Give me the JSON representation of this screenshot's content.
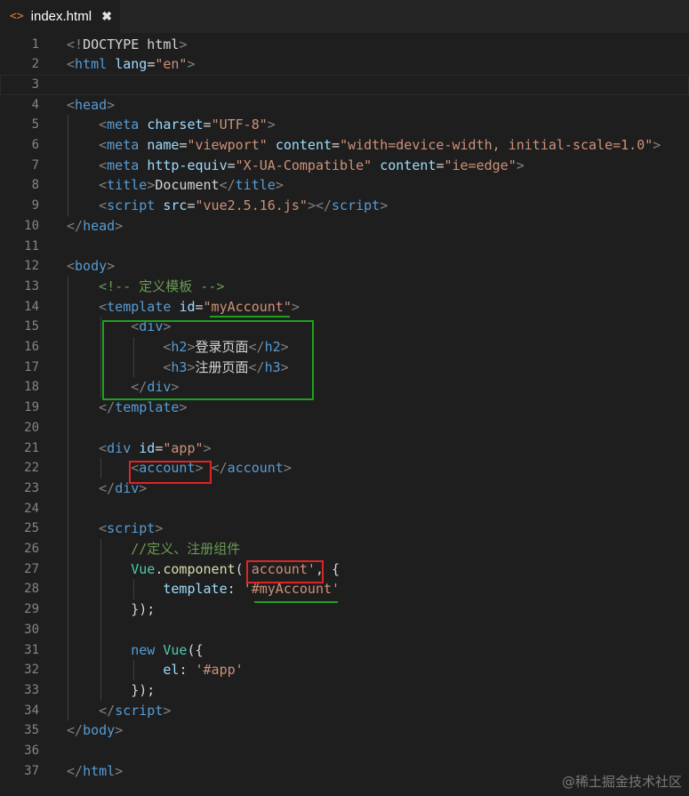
{
  "tab": {
    "icon": "html-file-icon",
    "filename": "index.html",
    "close_glyph": "✖"
  },
  "lines": [
    [
      [
        "p",
        "<!"
      ],
      [
        "x",
        "DOCTYPE html"
      ],
      [
        "p",
        ">"
      ]
    ],
    [
      [
        "p",
        "<"
      ],
      [
        "t",
        "html"
      ],
      [
        "x",
        " "
      ],
      [
        "a",
        "lang"
      ],
      [
        "x",
        "="
      ],
      [
        "s",
        "\"en\""
      ],
      [
        "p",
        ">"
      ]
    ],
    [],
    [
      [
        "p",
        "<"
      ],
      [
        "t",
        "head"
      ],
      [
        "p",
        ">"
      ]
    ],
    [
      [
        "x",
        "    "
      ],
      [
        "p",
        "<"
      ],
      [
        "t",
        "meta"
      ],
      [
        "x",
        " "
      ],
      [
        "a",
        "charset"
      ],
      [
        "x",
        "="
      ],
      [
        "s",
        "\"UTF-8\""
      ],
      [
        "p",
        ">"
      ]
    ],
    [
      [
        "x",
        "    "
      ],
      [
        "p",
        "<"
      ],
      [
        "t",
        "meta"
      ],
      [
        "x",
        " "
      ],
      [
        "a",
        "name"
      ],
      [
        "x",
        "="
      ],
      [
        "s",
        "\"viewport\""
      ],
      [
        "x",
        " "
      ],
      [
        "a",
        "content"
      ],
      [
        "x",
        "="
      ],
      [
        "s",
        "\"width=device-width, initial-scale=1.0\""
      ],
      [
        "p",
        ">"
      ]
    ],
    [
      [
        "x",
        "    "
      ],
      [
        "p",
        "<"
      ],
      [
        "t",
        "meta"
      ],
      [
        "x",
        " "
      ],
      [
        "a",
        "http-equiv"
      ],
      [
        "x",
        "="
      ],
      [
        "s",
        "\"X-UA-Compatible\""
      ],
      [
        "x",
        " "
      ],
      [
        "a",
        "content"
      ],
      [
        "x",
        "="
      ],
      [
        "s",
        "\"ie=edge\""
      ],
      [
        "p",
        ">"
      ]
    ],
    [
      [
        "x",
        "    "
      ],
      [
        "p",
        "<"
      ],
      [
        "t",
        "title"
      ],
      [
        "p",
        ">"
      ],
      [
        "x",
        "Document"
      ],
      [
        "p",
        "</"
      ],
      [
        "t",
        "title"
      ],
      [
        "p",
        ">"
      ]
    ],
    [
      [
        "x",
        "    "
      ],
      [
        "p",
        "<"
      ],
      [
        "t",
        "script"
      ],
      [
        "x",
        " "
      ],
      [
        "a",
        "src"
      ],
      [
        "x",
        "="
      ],
      [
        "s",
        "\"vue2.5.16.js\""
      ],
      [
        "p",
        "></"
      ],
      [
        "t",
        "script"
      ],
      [
        "p",
        ">"
      ]
    ],
    [
      [
        "p",
        "</"
      ],
      [
        "t",
        "head"
      ],
      [
        "p",
        ">"
      ]
    ],
    [],
    [
      [
        "p",
        "<"
      ],
      [
        "t",
        "body"
      ],
      [
        "p",
        ">"
      ]
    ],
    [
      [
        "x",
        "    "
      ],
      [
        "c",
        "<!-- 定义模板 -->"
      ]
    ],
    [
      [
        "x",
        "    "
      ],
      [
        "p",
        "<"
      ],
      [
        "t",
        "template"
      ],
      [
        "x",
        " "
      ],
      [
        "a",
        "id"
      ],
      [
        "x",
        "="
      ],
      [
        "s",
        "\"myAccount\""
      ],
      [
        "p",
        ">"
      ]
    ],
    [
      [
        "x",
        "        "
      ],
      [
        "p",
        "<"
      ],
      [
        "t",
        "div"
      ],
      [
        "p",
        ">"
      ]
    ],
    [
      [
        "x",
        "            "
      ],
      [
        "p",
        "<"
      ],
      [
        "t",
        "h2"
      ],
      [
        "p",
        ">"
      ],
      [
        "x",
        "登录页面"
      ],
      [
        "p",
        "</"
      ],
      [
        "t",
        "h2"
      ],
      [
        "p",
        ">"
      ]
    ],
    [
      [
        "x",
        "            "
      ],
      [
        "p",
        "<"
      ],
      [
        "t",
        "h3"
      ],
      [
        "p",
        ">"
      ],
      [
        "x",
        "注册页面"
      ],
      [
        "p",
        "</"
      ],
      [
        "t",
        "h3"
      ],
      [
        "p",
        ">"
      ]
    ],
    [
      [
        "x",
        "        "
      ],
      [
        "p",
        "</"
      ],
      [
        "t",
        "div"
      ],
      [
        "p",
        ">"
      ]
    ],
    [
      [
        "x",
        "    "
      ],
      [
        "p",
        "</"
      ],
      [
        "t",
        "template"
      ],
      [
        "p",
        ">"
      ]
    ],
    [],
    [
      [
        "x",
        "    "
      ],
      [
        "p",
        "<"
      ],
      [
        "t",
        "div"
      ],
      [
        "x",
        " "
      ],
      [
        "a",
        "id"
      ],
      [
        "x",
        "="
      ],
      [
        "s",
        "\"app\""
      ],
      [
        "p",
        ">"
      ]
    ],
    [
      [
        "x",
        "        "
      ],
      [
        "p",
        "<"
      ],
      [
        "t",
        "account"
      ],
      [
        "p",
        ">"
      ],
      [
        "x",
        " "
      ],
      [
        "p",
        "</"
      ],
      [
        "t",
        "account"
      ],
      [
        "p",
        ">"
      ]
    ],
    [
      [
        "x",
        "    "
      ],
      [
        "p",
        "</"
      ],
      [
        "t",
        "div"
      ],
      [
        "p",
        ">"
      ]
    ],
    [],
    [
      [
        "x",
        "    "
      ],
      [
        "p",
        "<"
      ],
      [
        "t",
        "script"
      ],
      [
        "p",
        ">"
      ]
    ],
    [
      [
        "x",
        "        "
      ],
      [
        "c",
        "//定义、注册组件"
      ]
    ],
    [
      [
        "x",
        "        "
      ],
      [
        "n",
        "Vue"
      ],
      [
        "x",
        "."
      ],
      [
        "f",
        "component"
      ],
      [
        "x",
        "("
      ],
      [
        "s",
        "'account'"
      ],
      [
        "x",
        ", {"
      ]
    ],
    [
      [
        "x",
        "            "
      ],
      [
        "a",
        "template"
      ],
      [
        "x",
        ": "
      ],
      [
        "s",
        "'#myAccount'"
      ]
    ],
    [
      [
        "x",
        "        "
      ],
      [
        "x",
        "});"
      ]
    ],
    [],
    [
      [
        "x",
        "        "
      ],
      [
        "t",
        "new"
      ],
      [
        "x",
        " "
      ],
      [
        "n",
        "Vue"
      ],
      [
        "x",
        "({"
      ]
    ],
    [
      [
        "x",
        "            "
      ],
      [
        "a",
        "el"
      ],
      [
        "x",
        ": "
      ],
      [
        "s",
        "'#app'"
      ]
    ],
    [
      [
        "x",
        "        "
      ],
      [
        "x",
        "});"
      ]
    ],
    [
      [
        "x",
        "    "
      ],
      [
        "p",
        "</"
      ],
      [
        "t",
        "script"
      ],
      [
        "p",
        ">"
      ]
    ],
    [
      [
        "p",
        "</"
      ],
      [
        "t",
        "body"
      ],
      [
        "p",
        ">"
      ]
    ],
    [],
    [
      [
        "p",
        "</"
      ],
      [
        "t",
        "html"
      ],
      [
        "p",
        ">"
      ]
    ]
  ],
  "watermark": "@稀土掘金技术社区"
}
